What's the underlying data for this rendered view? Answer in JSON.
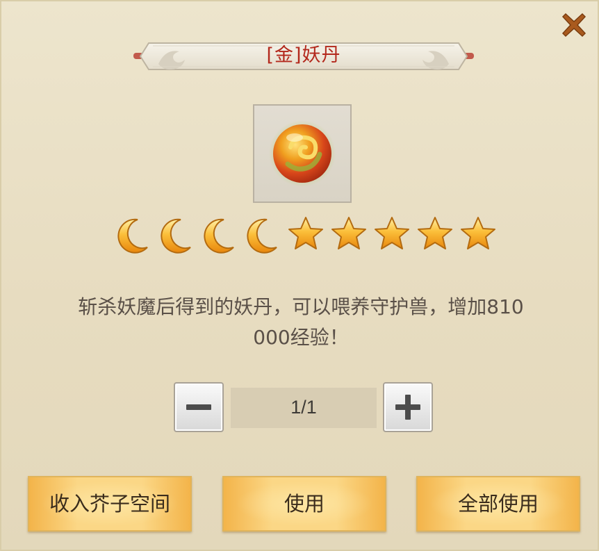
{
  "title": "[金]妖丹",
  "close_icon": "close-x-icon",
  "item": {
    "icon": "demon-pill-orb-icon"
  },
  "rating": {
    "moons": 4,
    "stars": 5,
    "moon_icon": "crescent-moon-icon",
    "star_icon": "star-icon"
  },
  "description": {
    "line1": "斩杀妖魔后得到的妖丹，可以喂养守护兽，增加810",
    "line2": "000经验！"
  },
  "quantity": {
    "value": "1/1",
    "minus_icon": "minus-icon",
    "plus_icon": "plus-icon"
  },
  "buttons": {
    "store": "收入芥子空间",
    "use": "使用",
    "use_all": "全部使用"
  },
  "colors": {
    "title": "#b3281c",
    "accent_button": "#fbd786",
    "moon_star_gold": "#f4a21e",
    "close_icon": "#a95a1e"
  }
}
